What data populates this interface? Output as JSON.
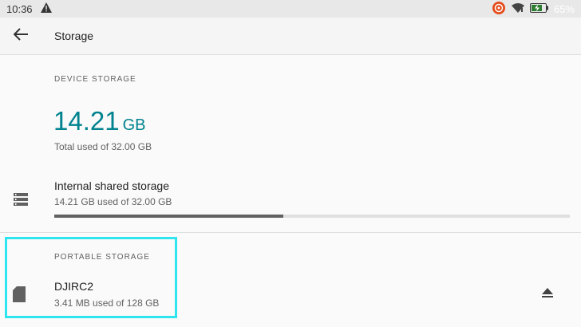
{
  "status_bar": {
    "time": "10:36",
    "battery_percent": "65%",
    "icons": [
      "alert-triangle-icon",
      "record-icon",
      "wifi-icon",
      "battery-charging-icon"
    ]
  },
  "app_bar": {
    "title": "Storage",
    "back_icon": "arrow-back-icon"
  },
  "device_storage": {
    "header": "DEVICE STORAGE",
    "total_value": "14.21",
    "total_unit": "GB",
    "total_sub": "Total used of 32.00 GB",
    "items": [
      {
        "title": "Internal shared storage",
        "subtitle": "14.21 GB used of 32.00 GB",
        "icon": "storage-list-icon",
        "used_fraction": 0.444
      }
    ]
  },
  "portable_storage": {
    "header": "PORTABLE STORAGE",
    "items": [
      {
        "title": "DJIRC2",
        "subtitle": "3.41 MB used of 128 GB",
        "icon": "sd-card-icon",
        "action_icon": "eject-icon"
      }
    ]
  },
  "colors": {
    "accent": "#00838f",
    "highlight": "#2fe6f0",
    "progress_fill": "#616161",
    "progress_track": "#e0e0e0"
  }
}
